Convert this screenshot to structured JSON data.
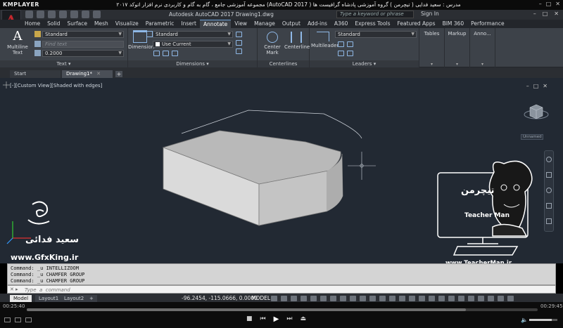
{
  "player": {
    "logo": "KMPLAYER",
    "title": "مجموعه آموزشی جامع ، گام به گام و کاربردی نرم افزار   اتوکد ۲۰۱۷ (AutoCAD 2017 )   مدرس : سعید فدایی ( تیچرمن ) گروه آموزشی پادشاه گرافیست ها",
    "time_elapsed": "00:25:40",
    "time_total": "00:29:45",
    "progress": 0.86,
    "volume": 0.8
  },
  "acad": {
    "window_title": "Autodesk AutoCAD 2017    Drawing1.dwg",
    "search_placeholder": "Type a keyword or phrase",
    "signin": "Sign In"
  },
  "ribbon": {
    "tabs": [
      "Home",
      "Solid",
      "Surface",
      "Mesh",
      "Visualize",
      "Parametric",
      "Insert",
      "Annotate",
      "View",
      "Manage",
      "Output",
      "Add-ins",
      "A360",
      "Express Tools",
      "Featured Apps",
      "BIM 360",
      "Performance"
    ],
    "active_tab": "Annotate",
    "text_panel": {
      "big_label": "Multiline Text",
      "style_value": "Standard",
      "find_placeholder": "Find text",
      "height_value": "0.2000",
      "label": "Text"
    },
    "dimensions_panel": {
      "big_label": "Dimension",
      "style_value": "Standard",
      "layer_value": "Use Current",
      "label": "Dimensions"
    },
    "centerlines_panel": {
      "center_mark": "Center Mark",
      "centerline": "Centerline",
      "label": "Centerlines"
    },
    "leaders_panel": {
      "big_label": "Multileader",
      "style_value": "Standard",
      "label": "Leaders"
    },
    "tables_panel": {
      "label": "Tables"
    },
    "markup_panel": {
      "label": "Markup"
    },
    "anno_panel": {
      "label": "Anno..."
    }
  },
  "filetabs": {
    "start": "Start",
    "drawing": "Drawing1*"
  },
  "viewport": {
    "view_label": "[-][Custom View][Shaded with edges]",
    "ucs_label": "Unnamed",
    "viewcube_face": "TOP"
  },
  "watermark": {
    "author_name": "سعید فدائی",
    "site_left": "www.GfxKing.ir",
    "teacher_brand": "تیچرمن",
    "teacher_tagline": "Teacher Man",
    "site_right": "www.TeacherMan.ir"
  },
  "command": {
    "history": [
      "Command:  _u INTELLIZOOM",
      "Command:  _u CHAMFER GROUP",
      "Command:  _u CHAMFER GROUP"
    ],
    "placeholder": "Type  a  command"
  },
  "status": {
    "layout_tabs": [
      "Model",
      "Layout1",
      "Layout2"
    ],
    "active_layout": "Model",
    "coords": "-96.2454, -115.0666, 0.0000",
    "mode": "MODEL"
  }
}
